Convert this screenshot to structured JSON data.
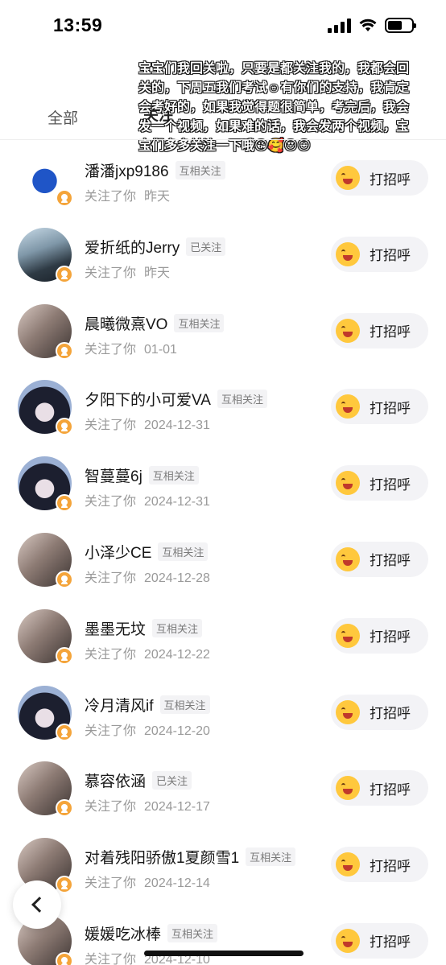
{
  "status_bar": {
    "time": "13:59"
  },
  "tabs": {
    "all": "全部",
    "following": "关注"
  },
  "overlay_caption": "宝宝们我回关啦，只要是都关注我的，我都会回关的，下周五我们考试☺有你们的支持，我肯定会考好的，如果我觉得题很简单，考完后，我会发一个视频，如果难的话，我会发两个视频，宝宝们多多关注一下哦😘🥰😍😊",
  "colors": {
    "badge": "#f4a43a",
    "button_bg": "#f3f3f6",
    "tag_bg": "#f3f3f5"
  },
  "users": [
    {
      "name": "潘潘jxp9186",
      "tag": "互相关注",
      "action": "关注了你",
      "date": "昨天",
      "button": "打招呼",
      "avatar": "lotus-logo"
    },
    {
      "name": "爱折纸的Jerry",
      "tag": "已关注",
      "action": "关注了你",
      "date": "昨天",
      "button": "打招呼",
      "avatar": "spaceship"
    },
    {
      "name": "晨曦微熹VO",
      "tag": "互相关注",
      "action": "关注了你",
      "date": "01-01",
      "button": "打招呼",
      "avatar": "photo"
    },
    {
      "name": "夕阳下的小可爱VA",
      "tag": "互相关注",
      "action": "关注了你",
      "date": "2024-12-31",
      "button": "打招呼",
      "avatar": "anime-girl"
    },
    {
      "name": "智蔓蔓6j",
      "tag": "互相关注",
      "action": "关注了你",
      "date": "2024-12-31",
      "button": "打招呼",
      "avatar": "anime-girl"
    },
    {
      "name": "小泽少CE",
      "tag": "互相关注",
      "action": "关注了你",
      "date": "2024-12-28",
      "button": "打招呼",
      "avatar": "photo"
    },
    {
      "name": "墨墨无坟",
      "tag": "互相关注",
      "action": "关注了你",
      "date": "2024-12-22",
      "button": "打招呼",
      "avatar": "photo"
    },
    {
      "name": "冷月清风if",
      "tag": "互相关注",
      "action": "关注了你",
      "date": "2024-12-20",
      "button": "打招呼",
      "avatar": "anime-girl"
    },
    {
      "name": "慕容依涵",
      "tag": "已关注",
      "action": "关注了你",
      "date": "2024-12-17",
      "button": "打招呼",
      "avatar": "photo"
    },
    {
      "name": "对着残阳骄傲1夏颜雪1",
      "tag": "互相关注",
      "action": "关注了你",
      "date": "2024-12-14",
      "button": "打招呼",
      "avatar": "photo"
    },
    {
      "name": "媛媛吃冰棒",
      "tag": "互相关注",
      "action": "关注了你",
      "date": "2024-12-10",
      "button": "打招呼",
      "avatar": "photo"
    }
  ]
}
